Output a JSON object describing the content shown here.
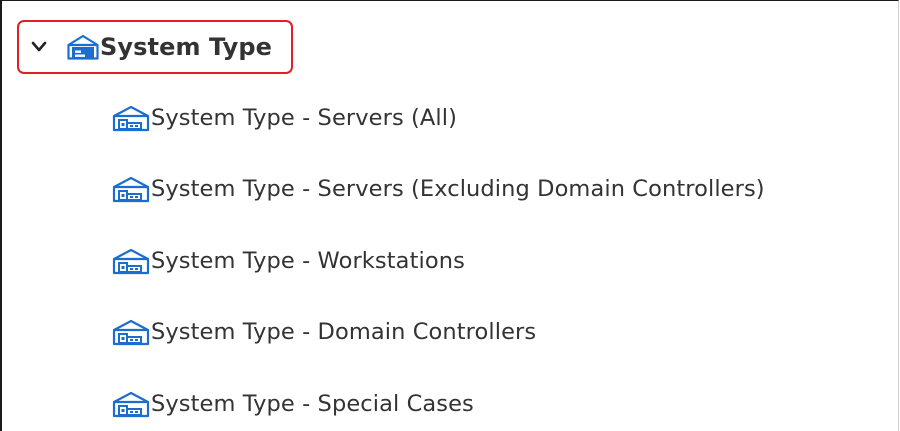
{
  "tree": {
    "parent": {
      "label": "System Type",
      "expanded": true,
      "icon": "building-icon",
      "icon_color": "#1b6ecf"
    },
    "children": [
      {
        "label": "System Type - Servers (All)",
        "icon": "building-icon"
      },
      {
        "label": "System Type - Servers (Excluding Domain Controllers)",
        "icon": "building-icon"
      },
      {
        "label": "System Type - Workstations",
        "icon": "building-icon"
      },
      {
        "label": "System Type - Domain Controllers",
        "icon": "building-icon"
      },
      {
        "label": "System Type - Special Cases",
        "icon": "building-icon"
      }
    ]
  },
  "colors": {
    "highlight_border": "#e11f26",
    "icon_blue": "#1b6ecf",
    "text": "#333333"
  }
}
